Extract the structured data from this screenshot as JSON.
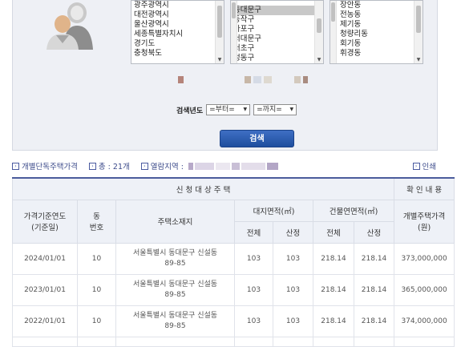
{
  "search": {
    "sido_list": [
      "광주광역시",
      "대전광역시",
      "울산광역시",
      "세종특별자치시",
      "경기도",
      "충청북도"
    ],
    "sigungu_list": [
      "",
      "동대문구",
      "동작구",
      "마포구",
      "서대문구",
      "서초구",
      "성동구"
    ],
    "dong_list": [
      "장안동",
      "전농동",
      "제기동",
      "청량리동",
      "회기동",
      "휘경동"
    ],
    "selected_sigungu": "동대문구",
    "year_label": "검색년도",
    "from_value": "=부터=",
    "to_value": "=까지=",
    "search_button": "검색"
  },
  "results": {
    "title": "개별단독주택가격",
    "total_prefix": "총 :",
    "total_count": "21개",
    "viewed_label": "열람지역 :",
    "print_label": "인쇄"
  },
  "table": {
    "group_header": "신 청 대 상 주 택",
    "confirm_header": "확 인 내 용",
    "col_year": "가격기준연도\n(기준일)",
    "col_dong": "동\n번호",
    "col_address": "주택소재지",
    "col_land": "대지면적(㎡)",
    "col_building": "건물연면적(㎡)",
    "col_price": "개별주택가격\n(원)",
    "sub_total": "전체",
    "sub_calc": "산정",
    "rows": [
      {
        "year": "2024/01/01",
        "dong": "10",
        "address": "서울특별시 동대문구 신설동\n89-85",
        "land_total": "103",
        "land_calc": "103",
        "bld_total": "218.14",
        "bld_calc": "218.14",
        "price": "373,000,000"
      },
      {
        "year": "2023/01/01",
        "dong": "10",
        "address": "서울특별시 동대문구 신설동\n89-85",
        "land_total": "103",
        "land_calc": "103",
        "bld_total": "218.14",
        "bld_calc": "218.14",
        "price": "365,000,000"
      },
      {
        "year": "2022/01/01",
        "dong": "10",
        "address": "서울특별시 동대문구 신설동\n89-85",
        "land_total": "103",
        "land_calc": "103",
        "bld_total": "218.14",
        "bld_calc": "218.14",
        "price": "374,000,000"
      }
    ]
  }
}
